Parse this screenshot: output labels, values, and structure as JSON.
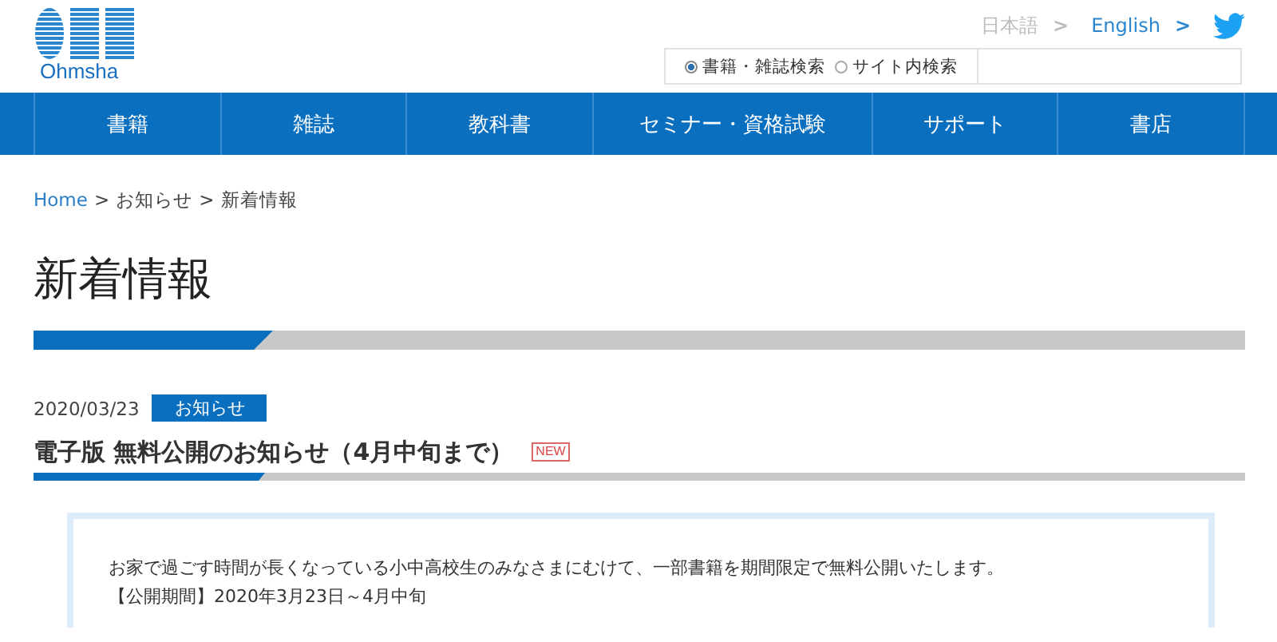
{
  "header": {
    "logo_text": "Ohmsha",
    "languages": [
      {
        "label": "日本語",
        "selected": true,
        "arrow": ">"
      },
      {
        "label": "English",
        "selected": false,
        "arrow": ">"
      }
    ],
    "search": {
      "options": [
        {
          "label": "書籍・雑誌検索",
          "selected": true
        },
        {
          "label": "サイト内検索",
          "selected": false
        }
      ]
    }
  },
  "nav": {
    "items": [
      {
        "label": "書籍"
      },
      {
        "label": "雑誌"
      },
      {
        "label": "教科書"
      },
      {
        "label": "セミナー・資格試験"
      },
      {
        "label": "サポート"
      },
      {
        "label": "書店"
      }
    ]
  },
  "breadcrumb": [
    {
      "label": "Home",
      "link": true
    },
    {
      "label": "お知らせ",
      "link": false
    },
    {
      "label": "新着情報",
      "link": false
    }
  ],
  "breadcrumb_separator": ">",
  "page_title": "新着情報",
  "news": {
    "date": "2020/03/23",
    "category": "お知らせ",
    "headline": "電子版 無料公開のお知らせ（4月中旬まで）",
    "new_badge": "NEW",
    "body": [
      "お家で過ごす時間が長くなっている小中高校生のみなさまにむけて、一部書籍を期間限定で無料公開いたします。",
      "【公開期間】2020年3月23日～4月中旬"
    ]
  }
}
